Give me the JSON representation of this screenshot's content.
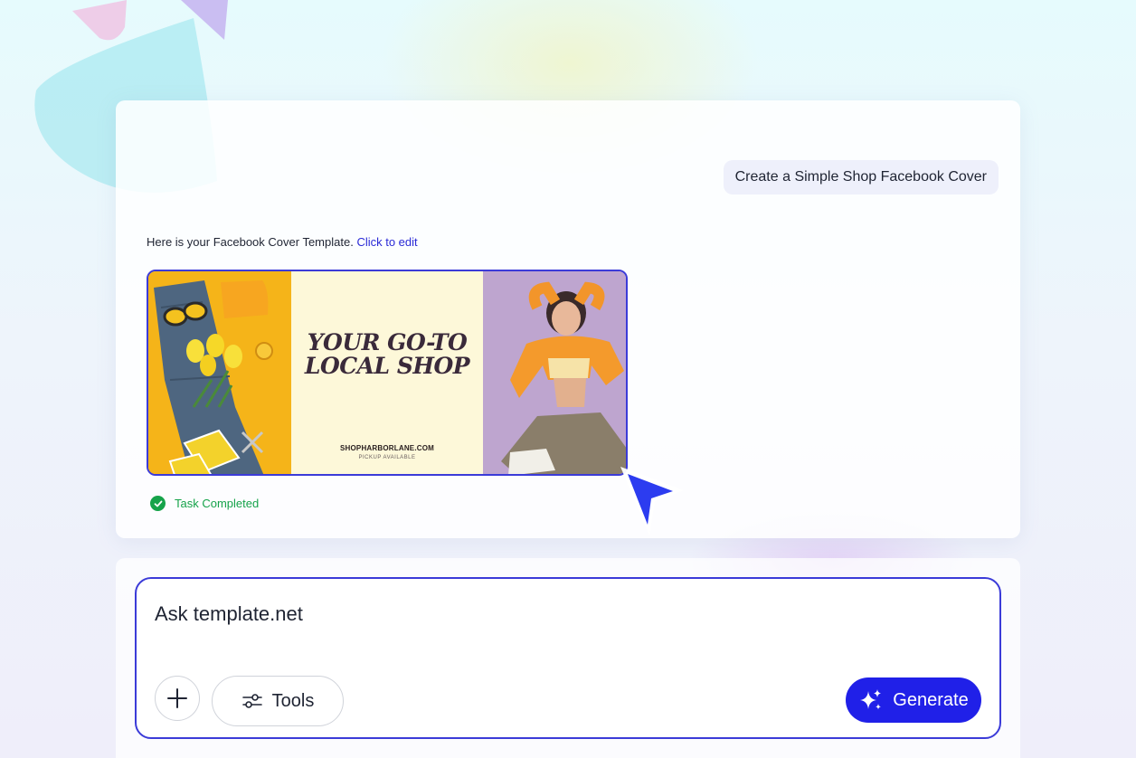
{
  "chat": {
    "user_message": "Create a Simple Shop Facebook Cover",
    "reply_text": "Here is your Facebook Cover Template.",
    "reply_link": "Click to edit",
    "status_text": "Task Completed"
  },
  "cover": {
    "headline_line1": "YOUR GO-TO",
    "headline_line2": "LOCAL SHOP",
    "website": "SHOPHARBORLANE.COM",
    "tagline": "PICKUP AVAILABLE"
  },
  "composer": {
    "placeholder": "Ask template.net",
    "tools_label": "Tools",
    "generate_label": "Generate"
  },
  "colors": {
    "accent": "#3b3bd8",
    "generate_button": "#2020e8",
    "success": "#16a34a"
  }
}
